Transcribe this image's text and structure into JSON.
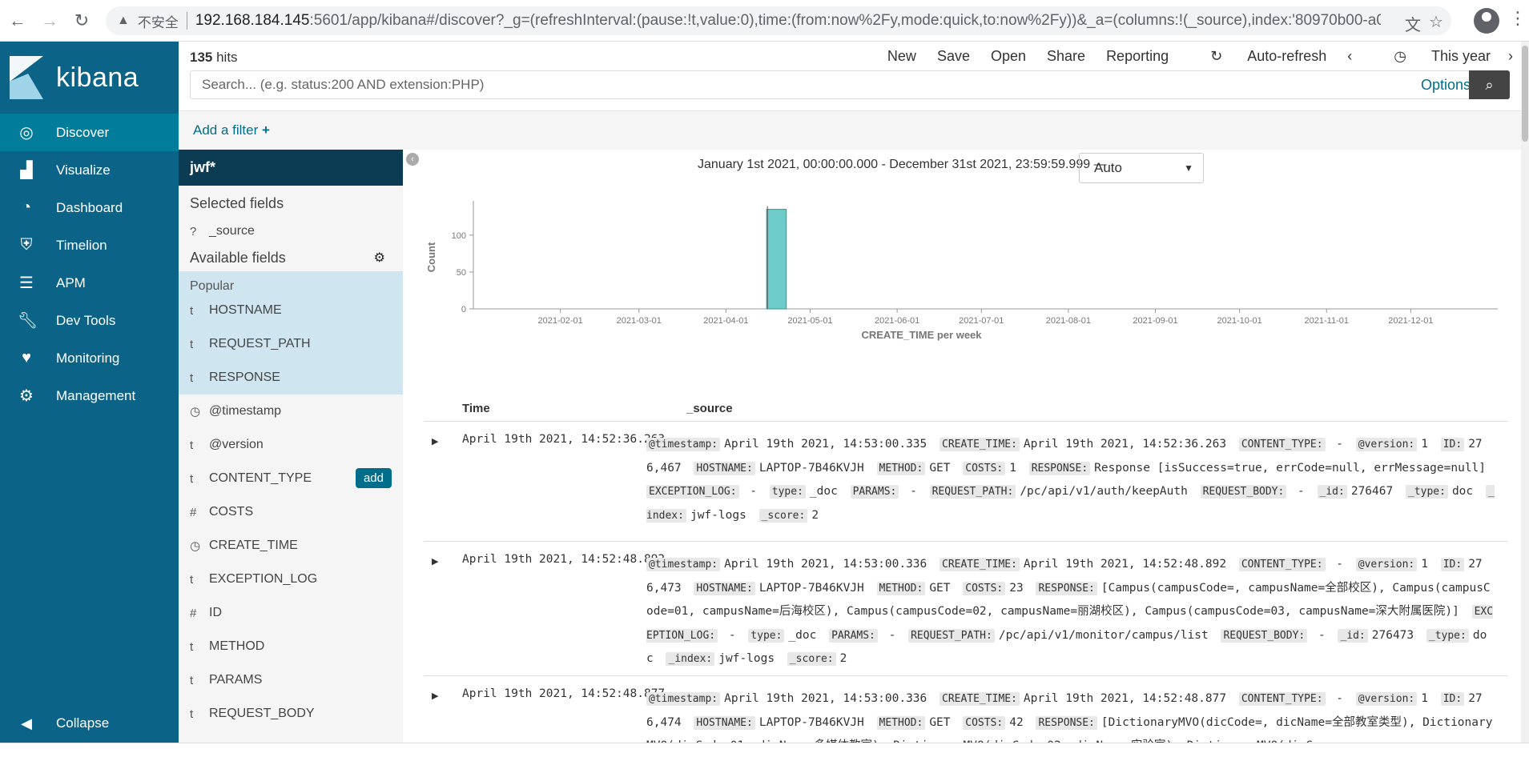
{
  "browser": {
    "insecure": "不安全",
    "url_host": "192.168.184.145",
    "url_rest": ":5601/app/kibana#/discover?_g=(refreshInterval:(pause:!t,value:0),time:(from:now%2Fy,mode:quick,to:now%2Fy))&_a=(columns:!(_source),index:'80970b00-a0d6-..."
  },
  "sidebar": {
    "logo": "kibana",
    "items": [
      {
        "label": "Discover",
        "icon": "compass-icon"
      },
      {
        "label": "Visualize",
        "icon": "bar-chart-icon"
      },
      {
        "label": "Dashboard",
        "icon": "dashboard-icon"
      },
      {
        "label": "Timelion",
        "icon": "shield-icon"
      },
      {
        "label": "APM",
        "icon": "list-icon"
      },
      {
        "label": "Dev Tools",
        "icon": "wrench-icon"
      },
      {
        "label": "Monitoring",
        "icon": "heartbeat-icon"
      },
      {
        "label": "Management",
        "icon": "gear-icon"
      }
    ],
    "collapse": "Collapse"
  },
  "topbar": {
    "hits_count": "135",
    "hits_label": " hits",
    "menu": [
      "New",
      "Save",
      "Open",
      "Share",
      "Reporting",
      "Auto-refresh",
      "This year"
    ],
    "search_placeholder": "Search... (e.g. status:200 AND extension:PHP)",
    "options": "Options"
  },
  "filter": {
    "add": "Add a filter"
  },
  "fields": {
    "index": "jwf*",
    "selected_title": "Selected fields",
    "selected": [
      {
        "type": "?",
        "name": "_source"
      }
    ],
    "available_title": "Available fields",
    "popular_label": "Popular",
    "popular": [
      {
        "type": "t",
        "name": "HOSTNAME"
      },
      {
        "type": "t",
        "name": "REQUEST_PATH"
      },
      {
        "type": "t",
        "name": "RESPONSE"
      }
    ],
    "others": [
      {
        "type": "◷",
        "name": "@timestamp"
      },
      {
        "type": "t",
        "name": "@version"
      },
      {
        "type": "t",
        "name": "CONTENT_TYPE"
      },
      {
        "type": "#",
        "name": "COSTS"
      },
      {
        "type": "◷",
        "name": "CREATE_TIME"
      },
      {
        "type": "t",
        "name": "EXCEPTION_LOG"
      },
      {
        "type": "#",
        "name": "ID"
      },
      {
        "type": "t",
        "name": "METHOD"
      },
      {
        "type": "t",
        "name": "PARAMS"
      },
      {
        "type": "t",
        "name": "REQUEST_BODY"
      }
    ],
    "add_label": "add"
  },
  "main": {
    "range": "January 1st 2021, 00:00:00.000 - December 31st 2021, 23:59:59.999 —",
    "interval": "Auto",
    "table_headers": [
      "Time",
      "_source"
    ]
  },
  "chart_data": {
    "type": "bar",
    "x_ticks": [
      "2021-02-01",
      "2021-03-01",
      "2021-04-01",
      "2021-05-01",
      "2021-06-01",
      "2021-07-01",
      "2021-08-01",
      "2021-09-01",
      "2021-10-01",
      "2021-11-01",
      "2021-12-01"
    ],
    "bars": [
      {
        "x": "2021-04-19",
        "value": 135
      }
    ],
    "ylabel": "Count",
    "xlabel": "CREATE_TIME per week",
    "y_ticks": [
      0,
      50,
      100
    ],
    "ylim": [
      0,
      140
    ],
    "bar_color": "#6dccca"
  },
  "rows": [
    {
      "time": "April 19th 2021, 14:52:36.263",
      "fields": [
        [
          "@timestamp:",
          "April 19th 2021, 14:53:00.335"
        ],
        [
          "CREATE_TIME:",
          "April 19th 2021, 14:52:36.263"
        ],
        [
          "CONTENT_TYPE:",
          " - "
        ],
        [
          "@version:",
          "1"
        ],
        [
          "ID:",
          "276,467"
        ],
        [
          "HOSTNAME:",
          "LAPTOP-7B46KVJH"
        ],
        [
          "METHOD:",
          "GET"
        ],
        [
          "COSTS:",
          "1"
        ],
        [
          "RESPONSE:",
          "Response [isSuccess=true, errCode=null, errMessage=null]"
        ],
        [
          "EXCEPTION_LOG:",
          " - "
        ],
        [
          "type:",
          "_doc"
        ],
        [
          "PARAMS:",
          " - "
        ],
        [
          "REQUEST_PATH:",
          "/pc/api/v1/auth/keepAuth"
        ],
        [
          "REQUEST_BODY:",
          " - "
        ],
        [
          "_id:",
          "276467"
        ],
        [
          "_type:",
          "doc"
        ],
        [
          "_index:",
          "jwf-logs"
        ],
        [
          "_score:",
          "2"
        ]
      ]
    },
    {
      "time": "April 19th 2021, 14:52:48.892",
      "fields": [
        [
          "@timestamp:",
          "April 19th 2021, 14:53:00.336"
        ],
        [
          "CREATE_TIME:",
          "April 19th 2021, 14:52:48.892"
        ],
        [
          "CONTENT_TYPE:",
          " - "
        ],
        [
          "@version:",
          "1"
        ],
        [
          "ID:",
          "276,473"
        ],
        [
          "HOSTNAME:",
          "LAPTOP-7B46KVJH"
        ],
        [
          "METHOD:",
          "GET"
        ],
        [
          "COSTS:",
          "23"
        ],
        [
          "RESPONSE:",
          "[Campus(campusCode=, campusName=全部校区), Campus(campusCode=01, campusName=后海校区), Campus(campusCode=02, campusName=丽湖校区), Campus(campusCode=03, campusName=深大附属医院)]"
        ],
        [
          "EXCEPTION_LOG:",
          " - "
        ],
        [
          "type:",
          "_doc"
        ],
        [
          "PARAMS:",
          " - "
        ],
        [
          "REQUEST_PATH:",
          "/pc/api/v1/monitor/campus/list"
        ],
        [
          "REQUEST_BODY:",
          " - "
        ],
        [
          "_id:",
          "276473"
        ],
        [
          "_type:",
          "doc"
        ],
        [
          "_index:",
          "jwf-logs"
        ],
        [
          "_score:",
          "2"
        ]
      ]
    },
    {
      "time": "April 19th 2021, 14:52:48.877",
      "fields": [
        [
          "@timestamp:",
          "April 19th 2021, 14:53:00.336"
        ],
        [
          "CREATE_TIME:",
          "April 19th 2021, 14:52:48.877"
        ],
        [
          "CONTENT_TYPE:",
          " - "
        ],
        [
          "@version:",
          "1"
        ],
        [
          "ID:",
          "276,474"
        ],
        [
          "HOSTNAME:",
          "LAPTOP-7B46KVJH"
        ],
        [
          "METHOD:",
          "GET"
        ],
        [
          "COSTS:",
          "42"
        ],
        [
          "RESPONSE:",
          "[DictionaryMVO(dicCode=, dicName=全部教室类型), DictionaryMVO(dicCode=01, dicName=多媒体教室), DictionaryMVO(dicCode=02, dicName=实验室), DictionaryMVO(dicC"
        ]
      ]
    }
  ]
}
